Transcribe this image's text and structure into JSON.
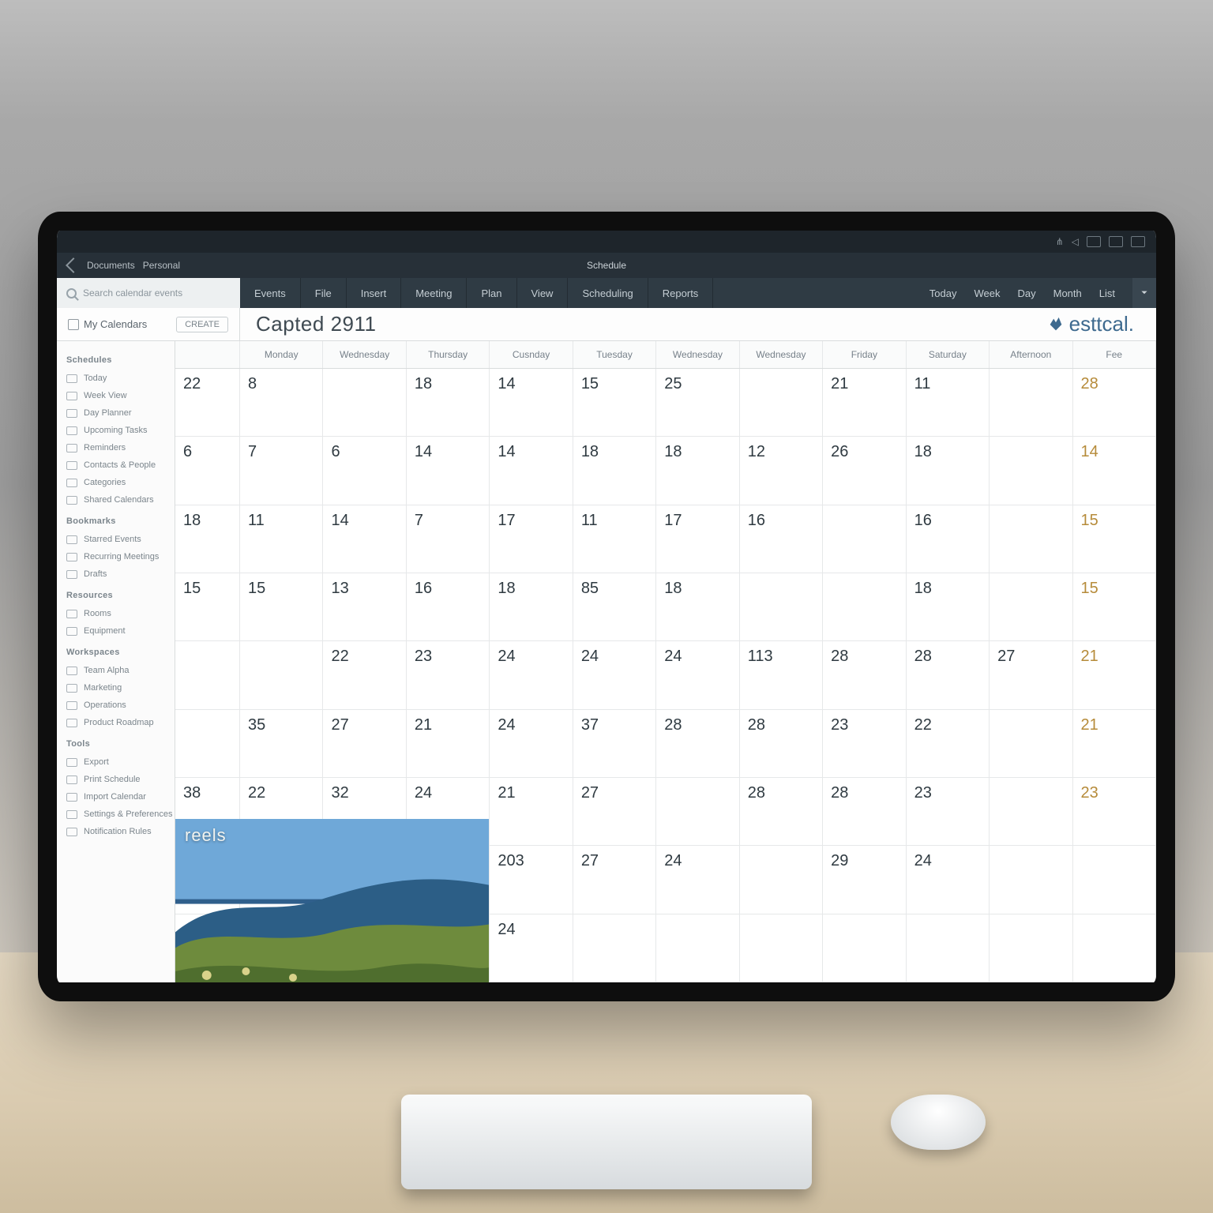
{
  "system": {
    "indicator_count": 5
  },
  "titlebar": {
    "back_hint": "Back",
    "path": "Documents",
    "path2": "Personal",
    "center": "Schedule"
  },
  "menubar": {
    "search_placeholder": "Search calendar events",
    "tabs": [
      "Events",
      "File",
      "Insert",
      "Meeting",
      "Plan",
      "View",
      "Scheduling",
      "Reports"
    ],
    "right": [
      "Today",
      "Week",
      "Day",
      "Month",
      "List"
    ]
  },
  "submenu": {
    "side_label": "My Calendars",
    "side_button": "CREATE",
    "title": "Capted 2911",
    "brand": "esttcal."
  },
  "sidebar": {
    "sections": [
      {
        "label": "Schedules",
        "items": [
          "Today",
          "Week View",
          "Day Planner",
          "Upcoming Tasks",
          "Reminders",
          "Contacts & People",
          "Categories",
          "Shared Calendars"
        ]
      },
      {
        "label": "Bookmarks",
        "items": [
          "Starred Events",
          "Recurring Meetings",
          "Drafts"
        ]
      },
      {
        "label": "Resources",
        "items": [
          "Rooms",
          "Equipment"
        ]
      },
      {
        "label": "Workspaces",
        "items": [
          "Team Alpha",
          "Marketing",
          "Operations",
          "Product Roadmap"
        ]
      },
      {
        "label": "Tools",
        "items": [
          "Export",
          "Print Schedule",
          "Import Calendar",
          "Settings & Preferences",
          "Notification Rules"
        ]
      }
    ]
  },
  "calendar": {
    "dow": [
      "",
      "Monday",
      "Wednesday",
      "Thursday",
      "Cusnday",
      "Tuesday",
      "Wednesday",
      "Wednesday",
      "Friday",
      "Saturday",
      "Afternoon",
      "Fee"
    ],
    "rows": [
      [
        "22",
        "8",
        "",
        "18",
        "14",
        "15",
        "25",
        "",
        "21",
        "11",
        "",
        "28"
      ],
      [
        "6",
        "7",
        "6",
        "14",
        "14",
        "18",
        "18",
        "12",
        "26",
        "18",
        "",
        "14"
      ],
      [
        "18",
        "11",
        "14",
        "7",
        "17",
        "11",
        "17",
        "16",
        "",
        "16",
        "",
        "15"
      ],
      [
        "15",
        "15",
        "13",
        "16",
        "18",
        "85",
        "18",
        "",
        "",
        "18",
        "",
        "15"
      ],
      [
        "",
        "",
        "22",
        "23",
        "24",
        "24",
        "24",
        "113",
        "28",
        "28",
        "27",
        "21"
      ],
      [
        "",
        "35",
        "27",
        "21",
        "24",
        "37",
        "28",
        "28",
        "23",
        "22",
        "",
        "21"
      ],
      [
        "38",
        "22",
        "32",
        "24",
        "21",
        "27",
        "",
        "28",
        "28",
        "23",
        "",
        "23"
      ],
      [
        "",
        "",
        "",
        "",
        "203",
        "27",
        "24",
        "",
        "29",
        "24",
        "",
        ""
      ],
      [
        "",
        "",
        "",
        "",
        "24",
        "",
        "",
        "",
        "",
        "",
        "",
        ""
      ]
    ],
    "gold_cols": [
      11
    ],
    "photo_label": "reels"
  },
  "colors": {
    "accent": "#3a6ea8",
    "gold": "#b68b3a"
  }
}
